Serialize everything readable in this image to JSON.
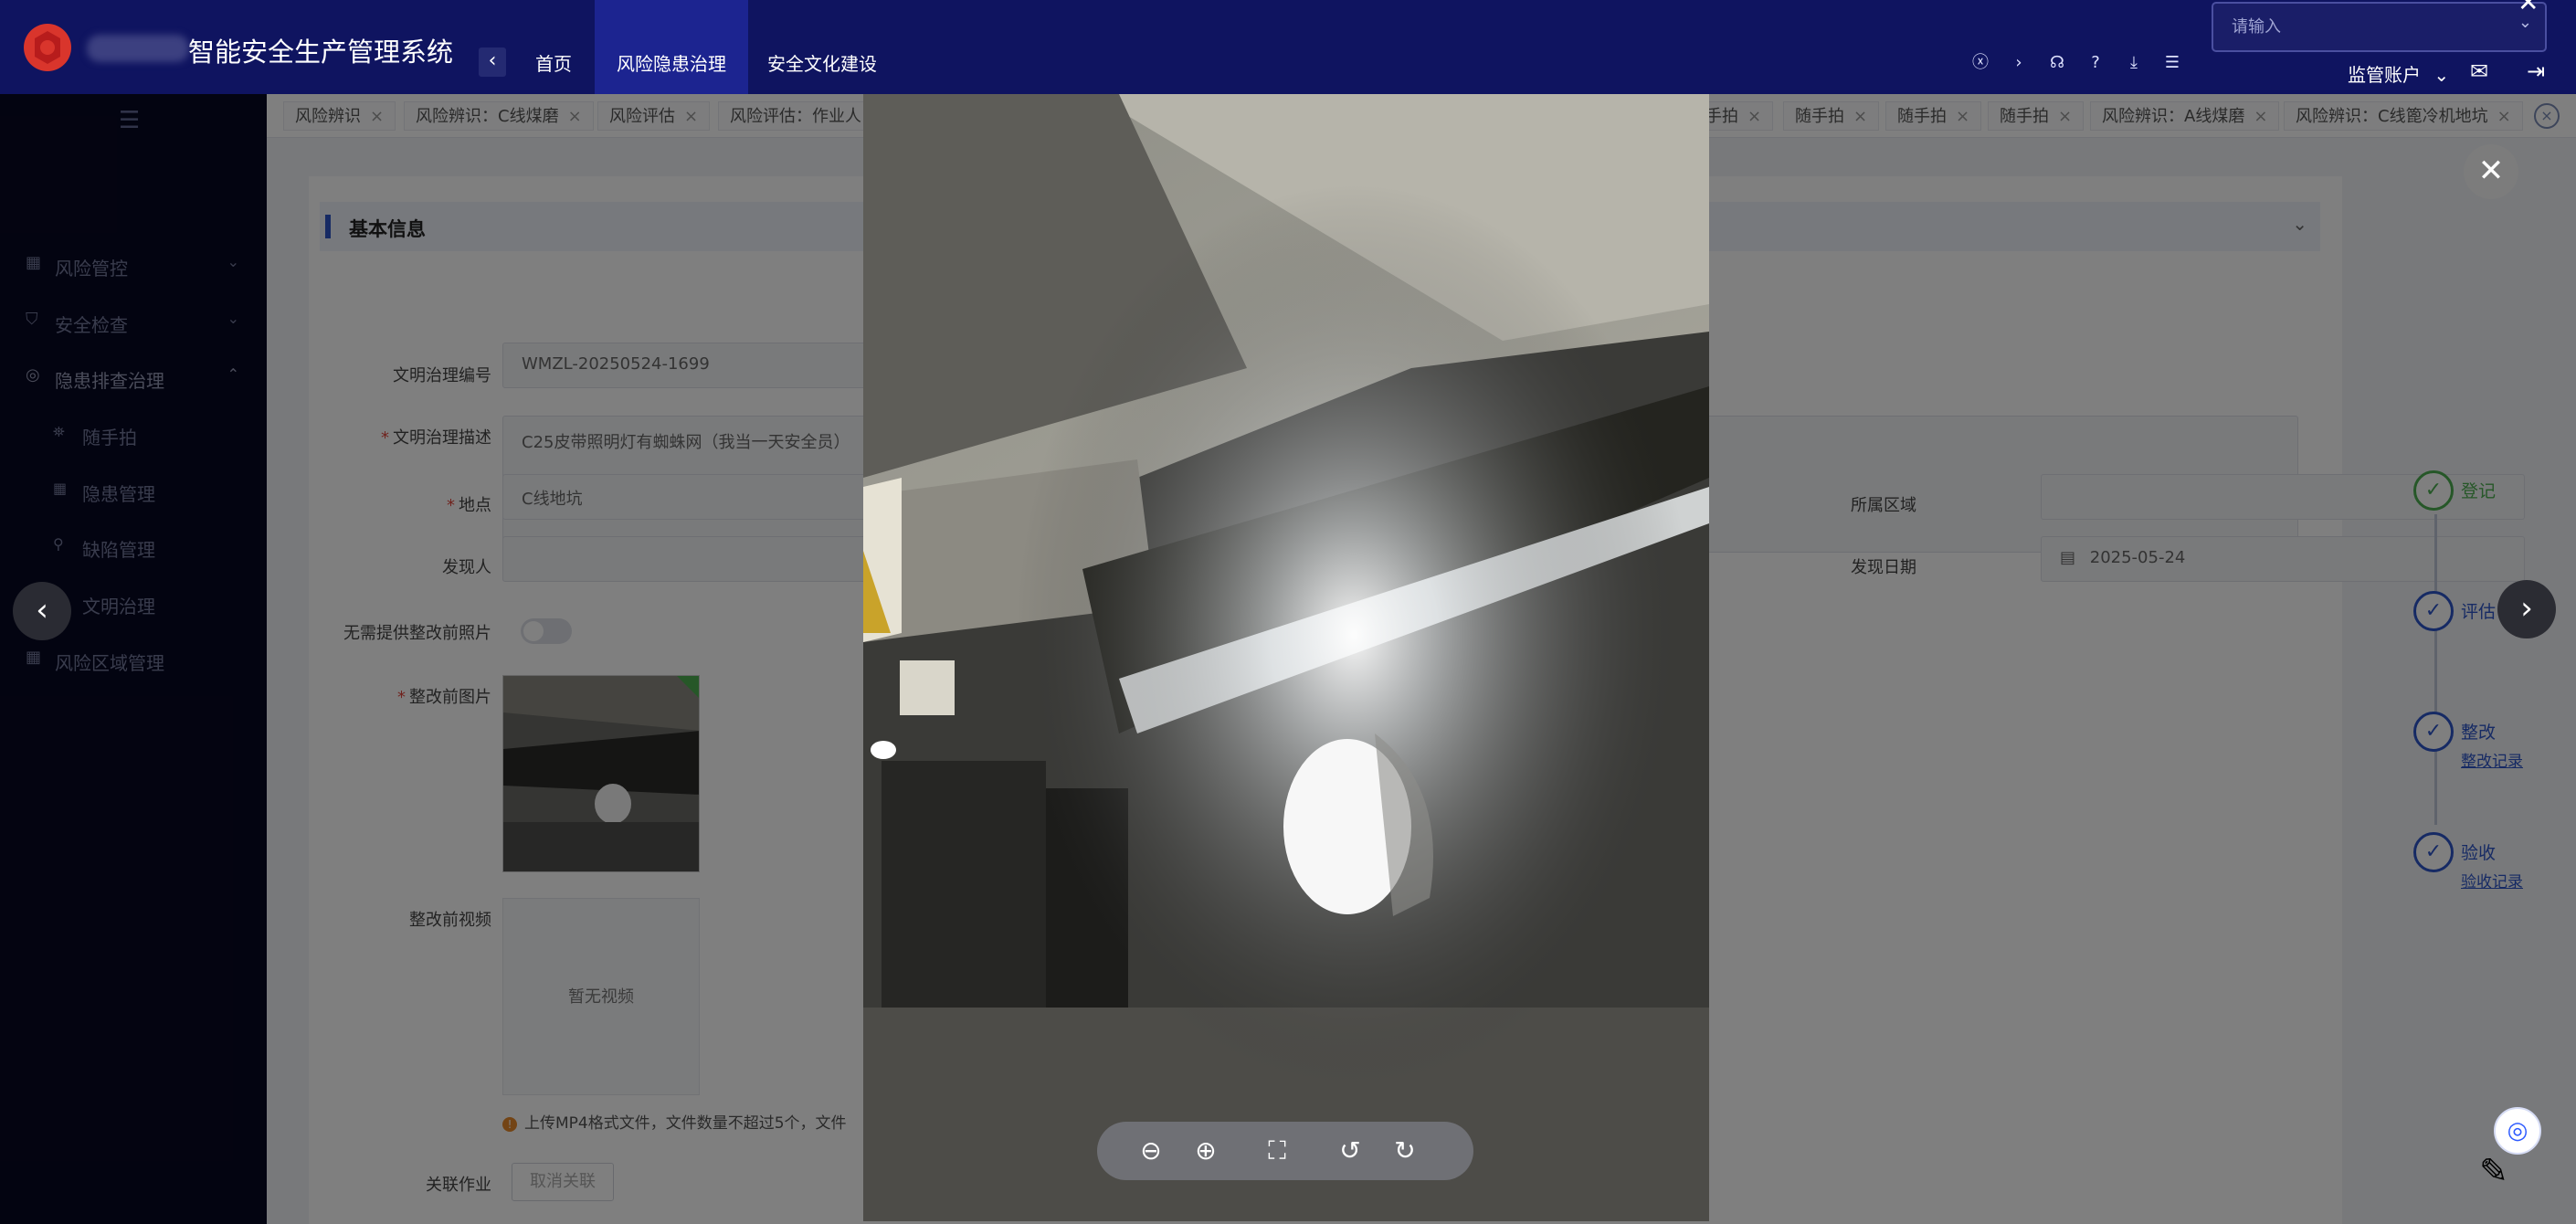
{
  "header": {
    "app_title": "智能安全生产管理系统",
    "nav_back": "‹",
    "nav_tabs": [
      {
        "label": "首页"
      },
      {
        "label": "风险隐患治理"
      },
      {
        "label": "安全文化建设"
      }
    ],
    "tool_icons": [
      "close-circle-icon",
      "chevron-right-icon",
      "headset-icon",
      "help-icon",
      "download-icon",
      "settings-sliders-icon"
    ],
    "search_placeholder": "请输入",
    "account_label": "监管账户",
    "active_color": "#1c2490"
  },
  "sidebar": {
    "menus": [
      {
        "icon": "▦",
        "label": "风险管控",
        "arrow": "⌄"
      },
      {
        "icon": "⛉",
        "label": "安全检查",
        "arrow": "⌄"
      },
      {
        "icon": "◎",
        "label": "隐患排查治理",
        "arrow": "⌃"
      },
      {
        "icon": "▦",
        "label": "风险区域管理",
        "arrow": ""
      }
    ],
    "sub_items": [
      {
        "icon": "⛯",
        "label": "随手拍"
      },
      {
        "icon": "▦",
        "label": "隐患管理"
      },
      {
        "icon": "⚲",
        "label": "缺陷管理"
      },
      {
        "icon": "⚲",
        "label": "文明治理"
      }
    ]
  },
  "tabs": [
    {
      "label": "风险辨识"
    },
    {
      "label": "风险辨识：C线煤磨"
    },
    {
      "label": "风险评估"
    },
    {
      "label": "风险评估：作业人"
    },
    {
      "label": "手拍"
    },
    {
      "label": "随手拍"
    },
    {
      "label": "随手拍"
    },
    {
      "label": "随手拍"
    },
    {
      "label": "风险辨识：A线煤磨"
    },
    {
      "label": "风险辨识：C线篦冷机地坑"
    }
  ],
  "form": {
    "section_title": "基本信息",
    "code_label": "文明治理编号",
    "code_value": "WMZL-20250524-1699",
    "desc_label": "文明治理描述",
    "desc_value": "C25皮带照明灯有蜘蛛网（我当一天安全员）",
    "location_label": "地点",
    "location_value": "C线地坑",
    "area_label": "所属区域",
    "finder_label": "发现人",
    "date_label": "发现日期",
    "date_value": "2025-05-24",
    "no_photo_label": "无需提供整改前照片",
    "before_photo_label": "整改前图片",
    "before_video_label": "整改前视频",
    "no_video": "暂无视频",
    "upload_hint": "上传MP4格式文件，文件数量不超过5个，文件",
    "related_label": "关联作业",
    "unlink_button": "取消关联"
  },
  "steps": [
    {
      "name": "登记",
      "record": ""
    },
    {
      "name": "评估",
      "record": ""
    },
    {
      "name": "整改",
      "record": "整改记录"
    },
    {
      "name": "验收",
      "record": "验收记录"
    }
  ],
  "viewer": {
    "close": "✕",
    "prev": "‹",
    "next": "›",
    "toolbar_icons": [
      "zoom-out-icon",
      "zoom-in-icon",
      "fullscreen-icon",
      "rotate-left-icon",
      "rotate-right-icon"
    ]
  }
}
